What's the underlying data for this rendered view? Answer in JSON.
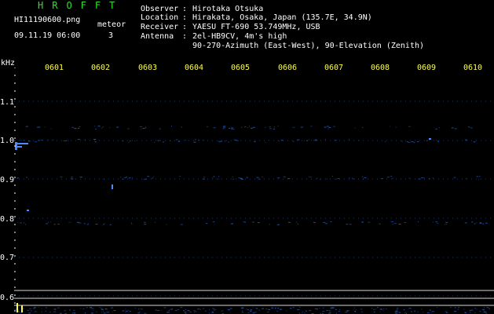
{
  "header": {
    "logo": "HROFFT",
    "filename": "HI11190600.png",
    "datetime": "09.11.19 06:00",
    "count_label": "meteor",
    "count_value": "3",
    "observer_label": "Observer",
    "observer": "Hirotaka Otsuka",
    "location_label": "Location",
    "location": "Hirakata, Osaka, Japan (135.7E, 34.9N)",
    "receiver_label": "Receiver",
    "receiver": "YAESU FT-690 53.749MHz, USB",
    "antenna_label": "Antenna",
    "antenna": "2el-HB9CV, 4m's high",
    "antenna_line2": "90-270-Azimuth (East-West), 90-Elevation (Zenith)"
  },
  "axis": {
    "unit": "kHz",
    "time_ticks": [
      "0601",
      "0602",
      "0603",
      "0604",
      "0605",
      "0606",
      "0607",
      "0608",
      "0609",
      "0610"
    ],
    "freq_ticks": [
      "1.1",
      "1.0",
      "0.9",
      "0.8",
      "0.7",
      "0.6"
    ]
  },
  "colors": {
    "background": "#000000",
    "grid": "#1a3a6a",
    "time_label": "#ffff44",
    "logo": "#33dd33",
    "signal": "#4a8cff",
    "noise": "#2255aa"
  }
}
